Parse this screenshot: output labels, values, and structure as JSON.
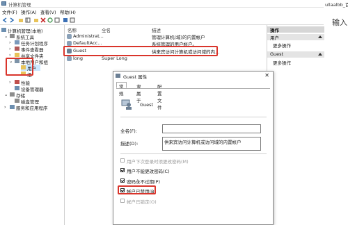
{
  "window": {
    "title": "计算机管理"
  },
  "right_edge": {
    "snippet": "ullaalbb_百",
    "char": "输入"
  },
  "menu": [
    "文件(F)",
    "操作(A)",
    "查看(V)",
    "帮助(H)"
  ],
  "tree": {
    "root": "计算机管理(本地)",
    "system_tools": "系统工具",
    "task_scheduler": "任务计划程序",
    "event_viewer": "事件查看器",
    "shared_folders": "共享文件夹",
    "local_users": "本地用户和组",
    "users": "用户",
    "groups": "组",
    "performance": "性能",
    "device_manager": "设备管理器",
    "storage": "存储",
    "disk_management": "磁盘管理",
    "services": "服务和应用程序"
  },
  "list": {
    "headers": [
      "名称",
      "全名",
      "描述"
    ],
    "rows": [
      {
        "name": "Administrat...",
        "fullname": "",
        "desc": "管理计算机(域)的内置帐户"
      },
      {
        "name": "DefaultAcc...",
        "fullname": "",
        "desc": "系统管理的用户帐户。"
      },
      {
        "name": "Guest",
        "fullname": "",
        "desc": "供来宾访问计算机或访问域的内..."
      },
      {
        "name": "long",
        "fullname": "Super Long",
        "desc": ""
      }
    ]
  },
  "actions": {
    "header": "操作",
    "section1": "用户",
    "more1": "更多操作",
    "section2": "Guest",
    "more2": "更多操作"
  },
  "dialog": {
    "title": "Guest 属性",
    "close": "✕",
    "tabs": [
      "常规",
      "隶属于",
      "配置文件"
    ],
    "username": "Guest",
    "fullname_label": "全名(F):",
    "fullname_value": "",
    "desc_label": "描述(D):",
    "desc_value": "供来宾访问计算机或访问域的内置帐户",
    "options": [
      {
        "label": "用户下次登录时须更改密码(M)",
        "checked": false,
        "disabled": true
      },
      {
        "label": "用户不能更改密码(C)",
        "checked": true,
        "disabled": false
      },
      {
        "label": "密码永不过期(P)",
        "checked": true,
        "disabled": false
      },
      {
        "label": "帐户已禁用(B)",
        "checked": true,
        "disabled": false
      },
      {
        "label": "帐户已锁定(O)",
        "checked": false,
        "disabled": true
      }
    ]
  },
  "colors": {
    "highlight": "#d9342b",
    "selection": "#cce8ff"
  }
}
